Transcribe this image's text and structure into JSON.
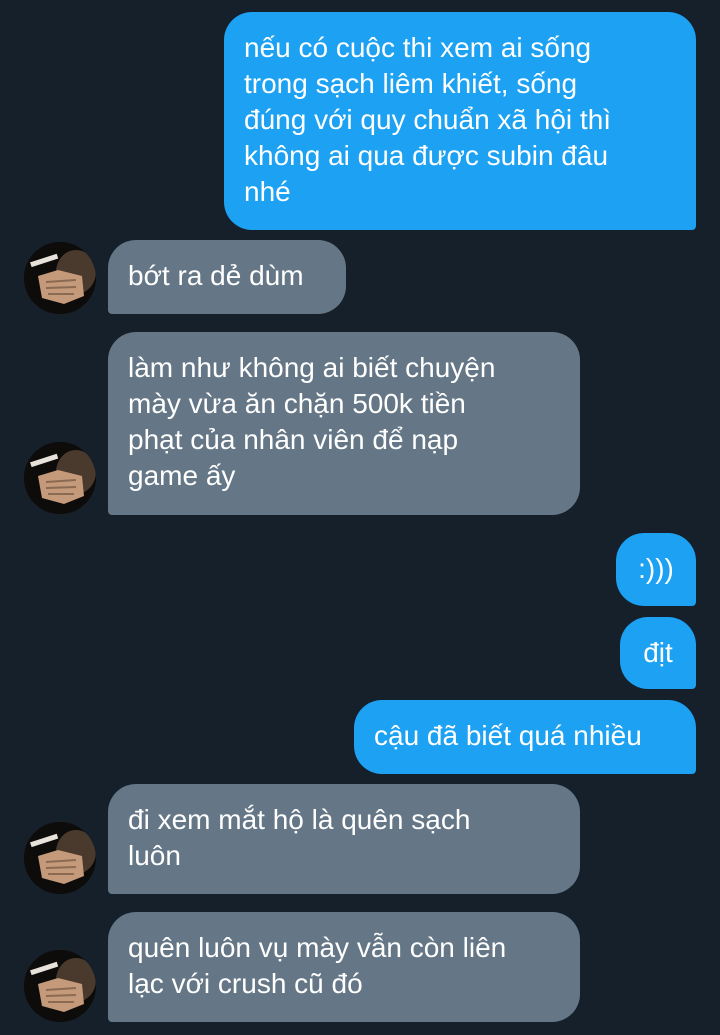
{
  "conversation": {
    "messages": [
      {
        "direction": "sent",
        "text": "nếu có cuộc thi xem ai sống\ntrong sạch liêm khiết, sống\nđúng với quy chuẩn xã hội thì\nkhông ai qua được subin đâu\nnhé"
      },
      {
        "direction": "received",
        "text": "bớt ra dẻ dùm"
      },
      {
        "direction": "received",
        "text": "làm như không ai biết chuyện\nmày vừa ăn chặn 500k tiền\nphạt của nhân viên để nạp\ngame ấy"
      },
      {
        "direction": "sent",
        "text": ":)))"
      },
      {
        "direction": "sent",
        "text": "địt"
      },
      {
        "direction": "sent",
        "text": "cậu đã biết quá nhiều"
      },
      {
        "direction": "received",
        "text": "đi xem mắt hộ là quên sạch\nluôn"
      },
      {
        "direction": "received",
        "text": "quên luôn vụ mày vẫn còn liên\nlạc với crush cũ đó"
      }
    ]
  },
  "colors": {
    "background": "#15202b",
    "sent_bubble": "#1da1f2",
    "received_bubble": "#657786",
    "text": "#ffffff"
  },
  "icons": {
    "contact_avatar": "avatar-photo-hand-cigarette"
  }
}
